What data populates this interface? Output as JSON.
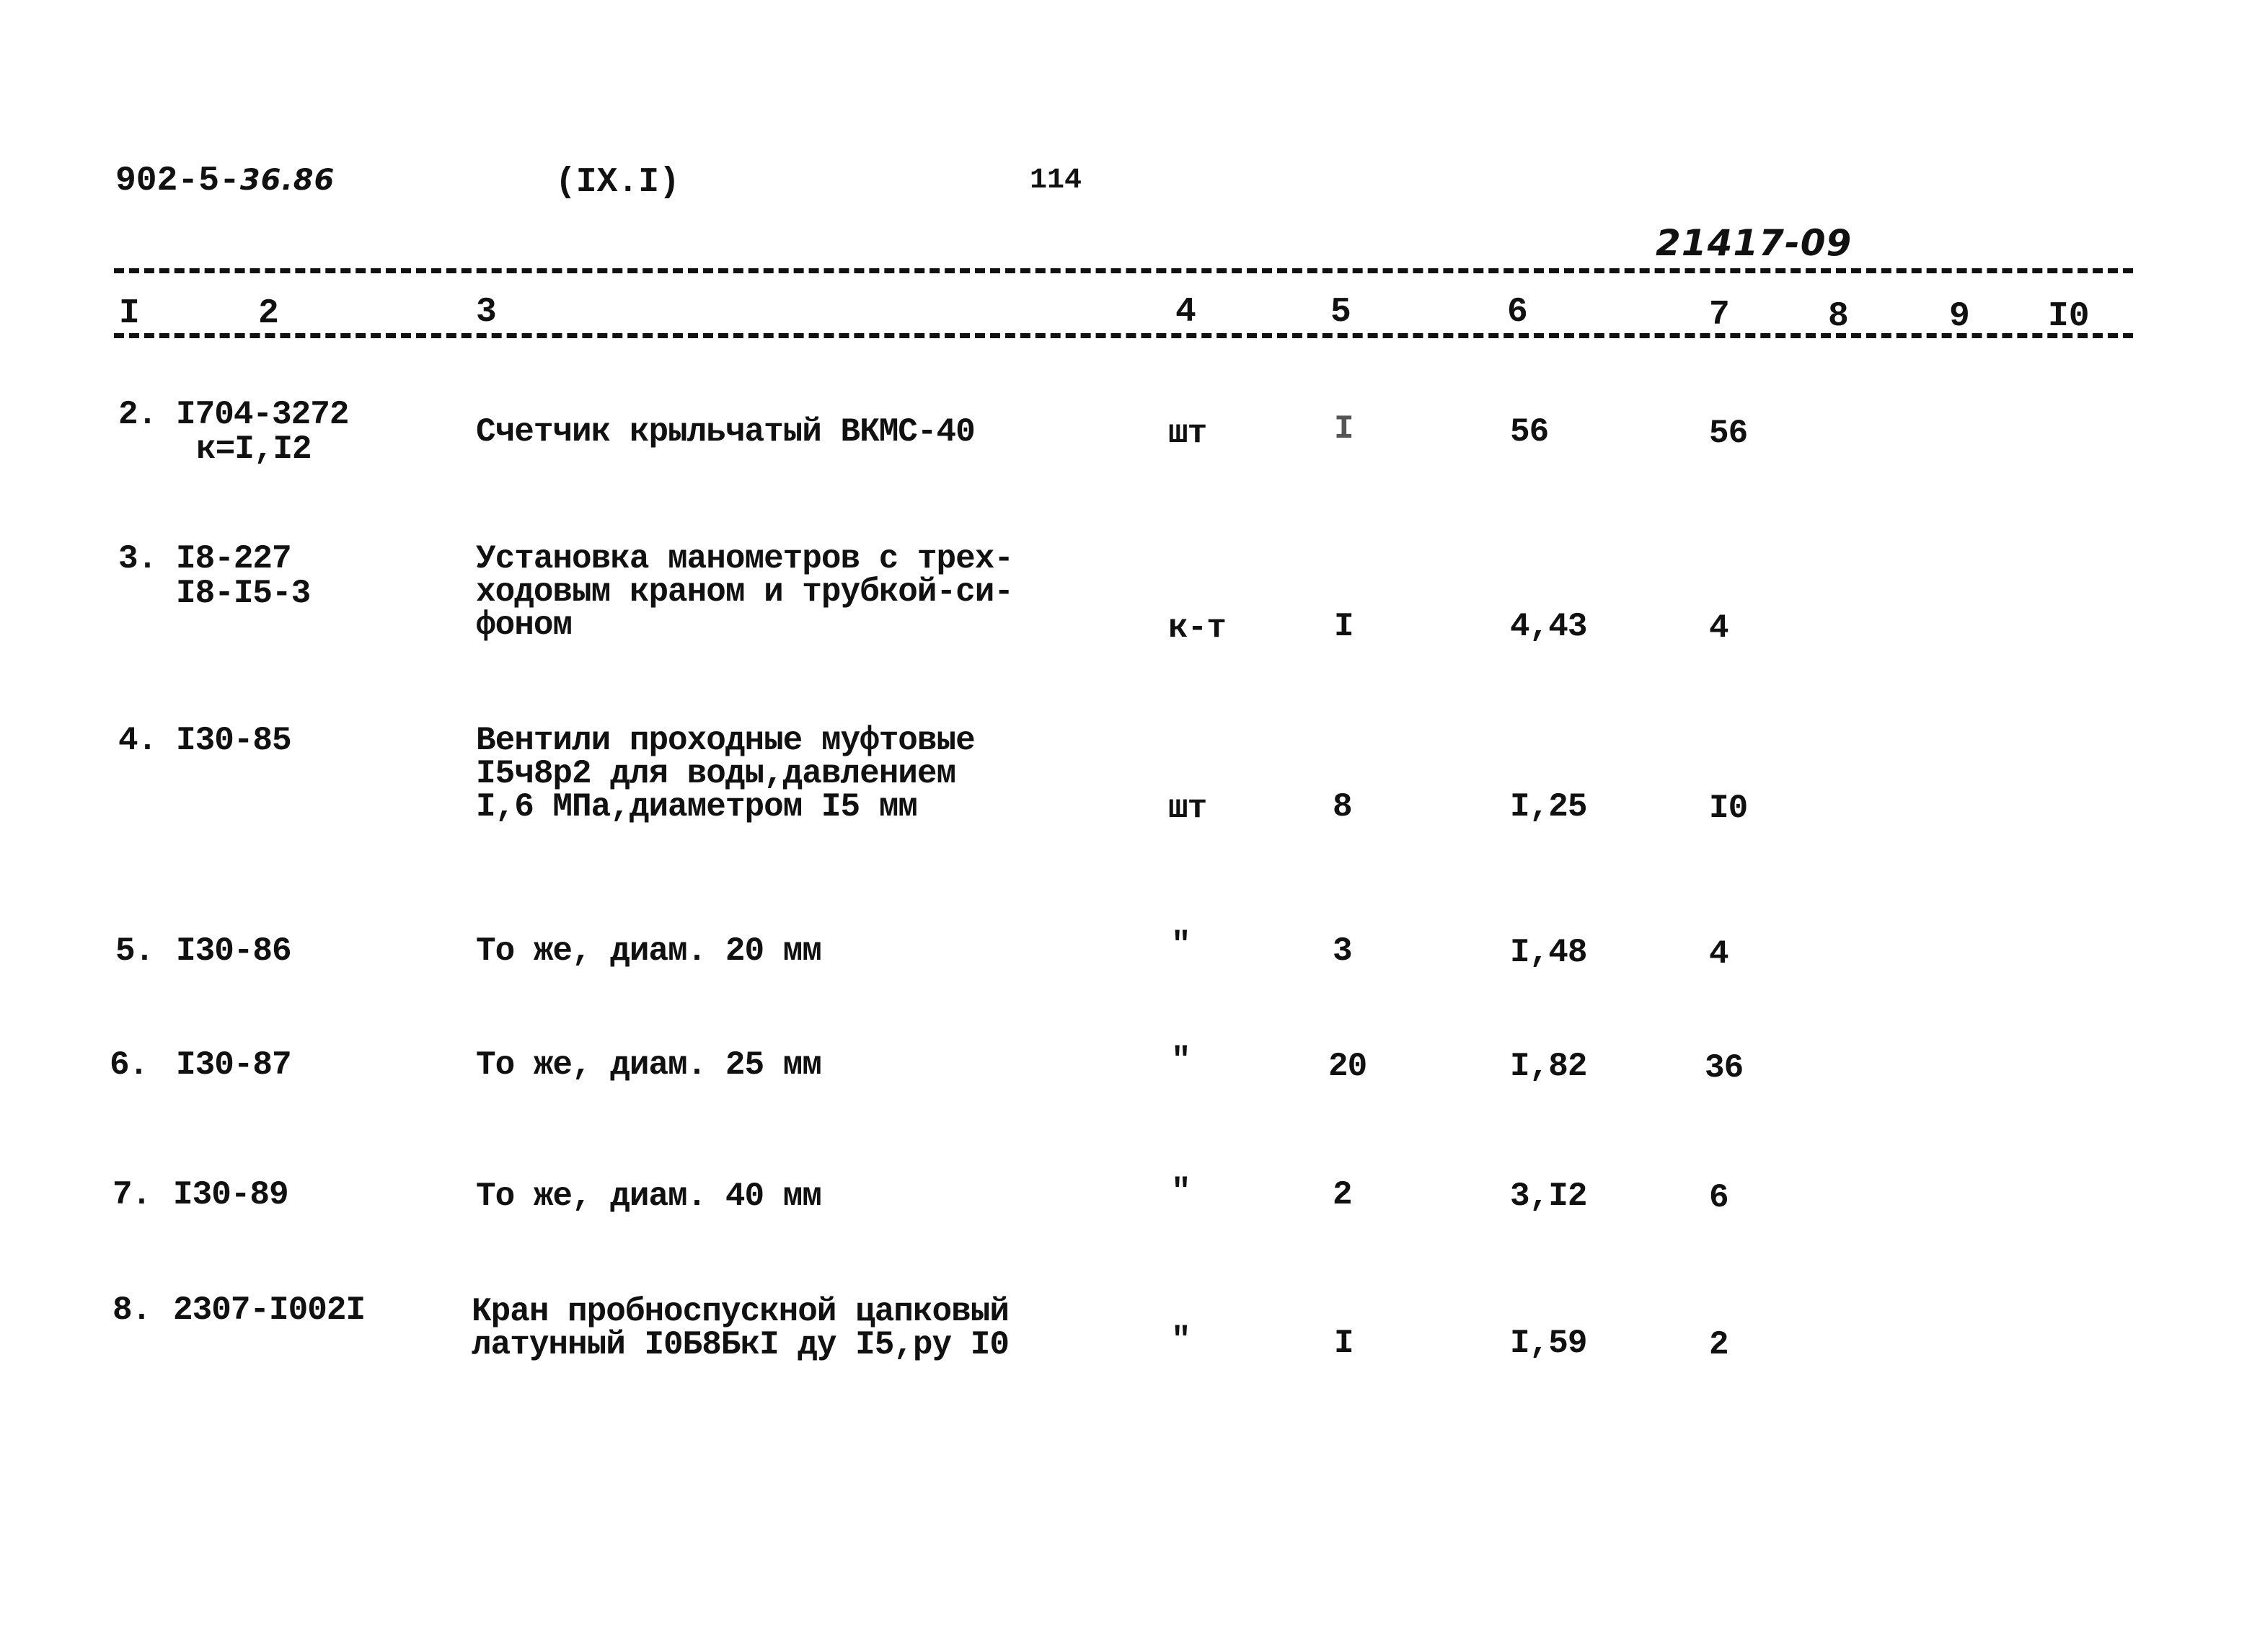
{
  "header": {
    "doc_code_prefix": "902-5-",
    "doc_code_suffix": "36.86",
    "section": "(IX.I)",
    "page_number": "114",
    "stamp_number": "21417-09"
  },
  "table": {
    "column_numbers": [
      "I",
      "2",
      "3",
      "4",
      "5",
      "6",
      "7",
      "8",
      "9",
      "I0"
    ],
    "rows": [
      {
        "num": "2.",
        "code": "I704-3272",
        "code_extra": "к=I,I2",
        "description": "Счетчик крыльчатый ВКМС-40",
        "unit": "шт",
        "qty": "I",
        "unit_cost": "56",
        "total": "56"
      },
      {
        "num": "3.",
        "code": "I8-227",
        "code_extra": "I8-I5-3",
        "description": "Установка манометров с трех-\nходовым краном и трубкой-си-\nфоном",
        "unit": "к-т",
        "qty": "I",
        "unit_cost": "4,43",
        "total": "4"
      },
      {
        "num": "4.",
        "code": "I30-85",
        "code_extra": "",
        "description": "Вентили проходные муфтовые\nI5ч8р2 для воды,давлением\nI,6 МПа,диаметром I5 мм",
        "unit": "шт",
        "qty": "8",
        "unit_cost": "I,25",
        "total": "I0"
      },
      {
        "num": "5.",
        "code": "I30-86",
        "code_extra": "",
        "description": "То же, диам. 20 мм",
        "unit": "\"",
        "qty": "3",
        "unit_cost": "I,48",
        "total": "4"
      },
      {
        "num": "6.",
        "code": "I30-87",
        "code_extra": "",
        "description": "То же, диам. 25 мм",
        "unit": "\"",
        "qty": "20",
        "unit_cost": "I,82",
        "total": "36"
      },
      {
        "num": "7.",
        "code": "I30-89",
        "code_extra": "",
        "description": "То же, диам. 40 мм",
        "unit": "\"",
        "qty": "2",
        "unit_cost": "3,I2",
        "total": "6"
      },
      {
        "num": "8.",
        "code": "2307-I002I",
        "code_extra": "",
        "description": "Кран пробноспускной цапковый\nлатунный I0Б8БкI ду I5,ру I0",
        "unit": "\"",
        "qty": "I",
        "unit_cost": "I,59",
        "total": "2"
      }
    ]
  }
}
